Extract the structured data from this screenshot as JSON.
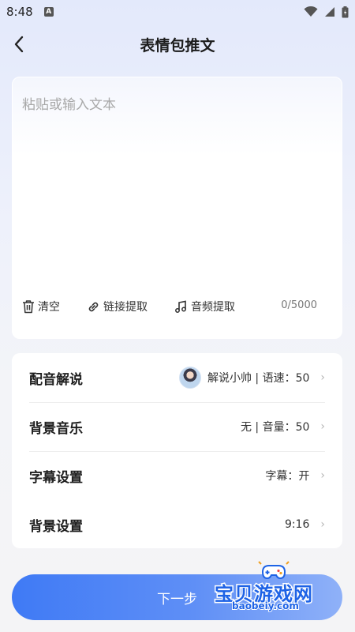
{
  "status_bar": {
    "time": "8:48",
    "notification_icon": "a-letter-icon",
    "icons": [
      "wifi-icon",
      "signal-icon",
      "battery-icon"
    ]
  },
  "header": {
    "title": "表情包推文",
    "back_icon": "chevron-left-icon"
  },
  "text_card": {
    "placeholder": "粘贴或输入文本",
    "value": "",
    "tools": {
      "clear": "清空",
      "link_extract": "链接提取",
      "audio_extract": "音频提取"
    },
    "counter": "0/5000"
  },
  "settings": [
    {
      "label": "配音解说",
      "value": "解说小帅 | 语速：50",
      "has_avatar": true
    },
    {
      "label": "背景音乐",
      "value": "无 | 音量：50"
    },
    {
      "label": "字幕设置",
      "value": "字幕：开"
    },
    {
      "label": "背景设置",
      "value": "9:16"
    }
  ],
  "next_button": {
    "label": "下一步"
  },
  "watermark": {
    "title": "宝贝游戏网",
    "url": "baobeiy.com"
  },
  "colors": {
    "accent": "#3f7af5",
    "watermark": "#1e63e6"
  }
}
